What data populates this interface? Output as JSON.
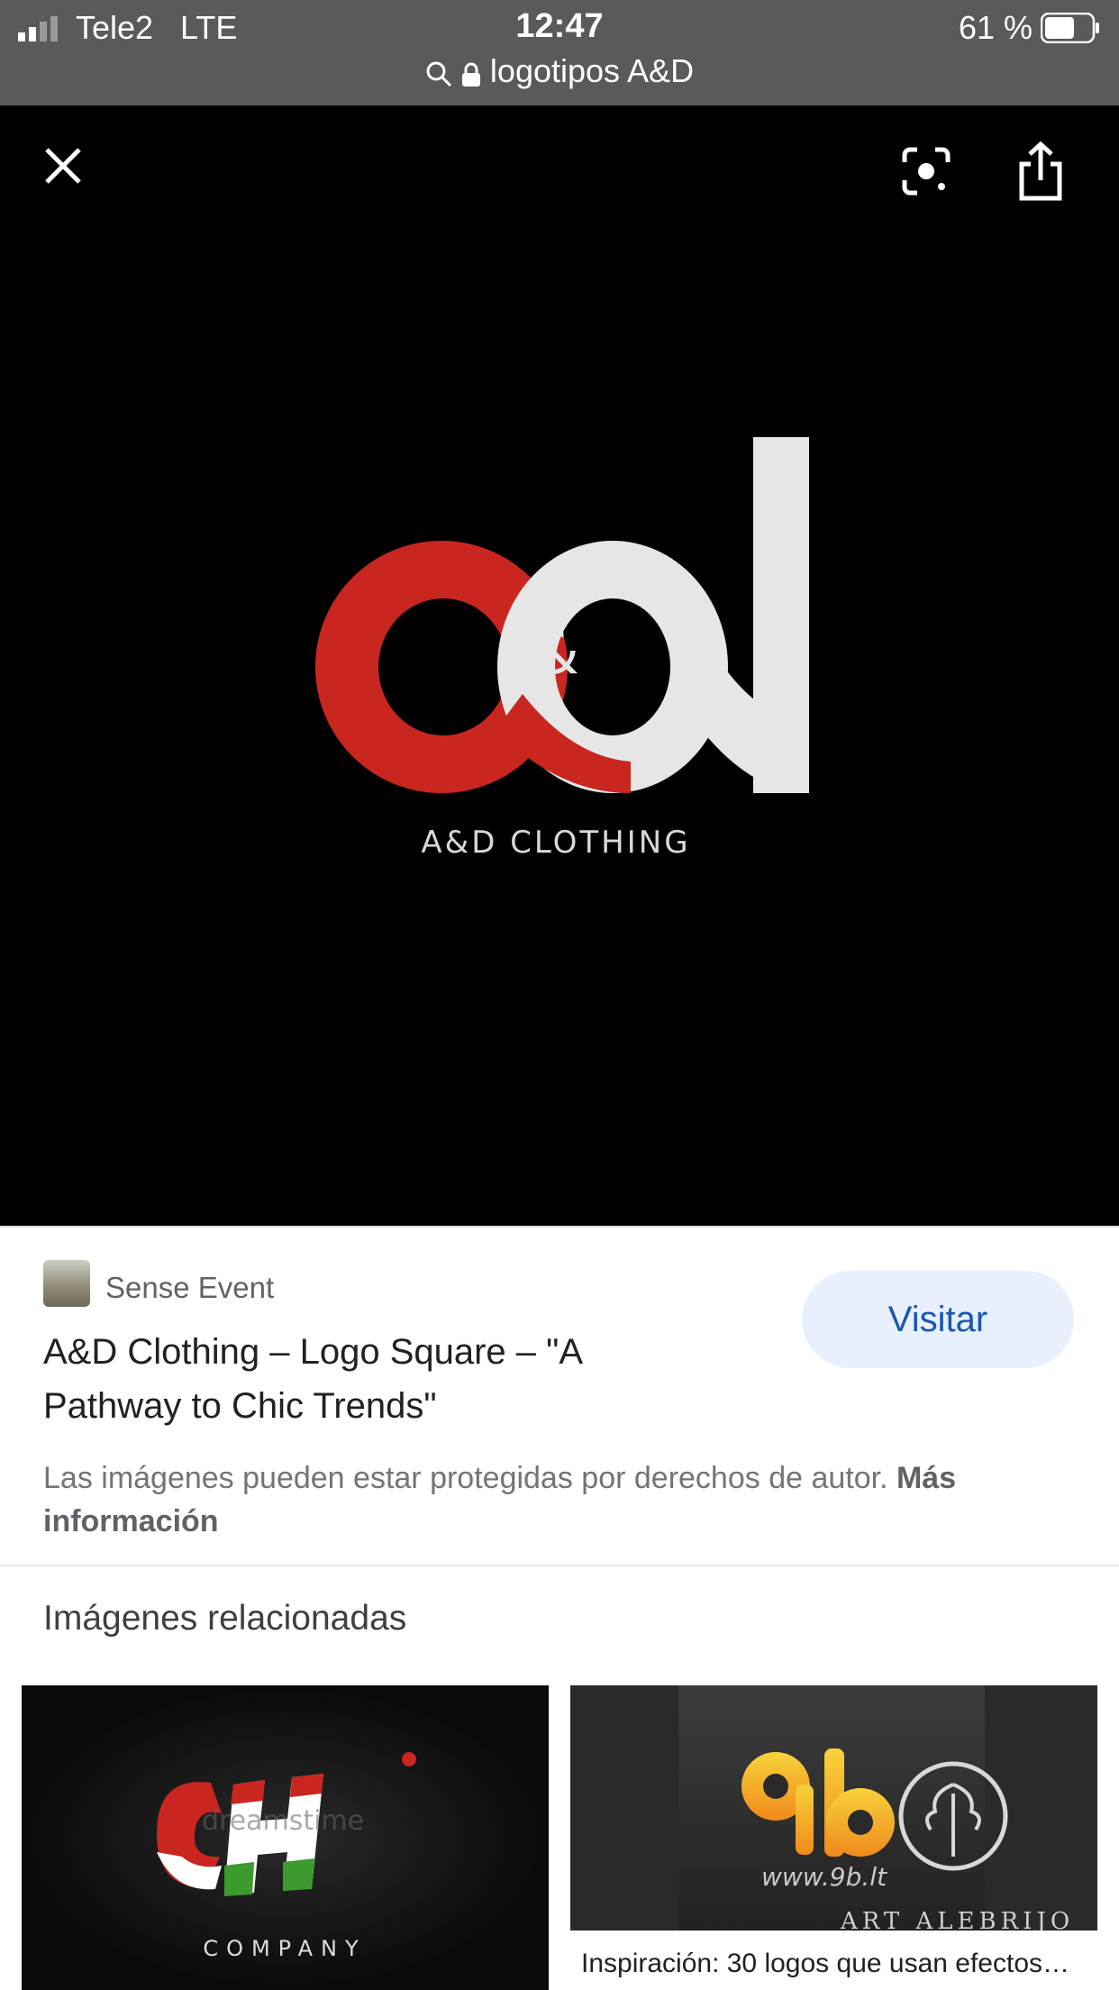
{
  "status_bar": {
    "carrier": "Tele2",
    "network": "LTE",
    "time": "12:47",
    "battery": "61 %"
  },
  "url_bar": {
    "query": "logotipos A&D"
  },
  "viewer": {
    "logo_text": "A&D CLOTHING",
    "ampersand": "&"
  },
  "result": {
    "source": "Sense Event",
    "title": "A&D Clothing – Logo Square – \"A Pathway to Chic Trends\"",
    "visit_label": "Visitar",
    "copyright": "Las imágenes pueden estar protegidas por derechos de autor.",
    "more_info": "Más información"
  },
  "related": {
    "heading": "Imágenes relacionadas",
    "items": [
      {
        "logo_text": "COMPANY",
        "watermark": "dreamstime"
      },
      {
        "logo_text": "www.9b.lt",
        "logo_sub": "ART ALEBRIJO",
        "caption": "Inspiración: 30 logos que usan efectos…"
      }
    ]
  },
  "colors": {
    "accent_red": "#c8261f",
    "logo_light": "#e6e6e6",
    "visit_bg": "#e8f0fe",
    "visit_text": "#1a57b4"
  }
}
